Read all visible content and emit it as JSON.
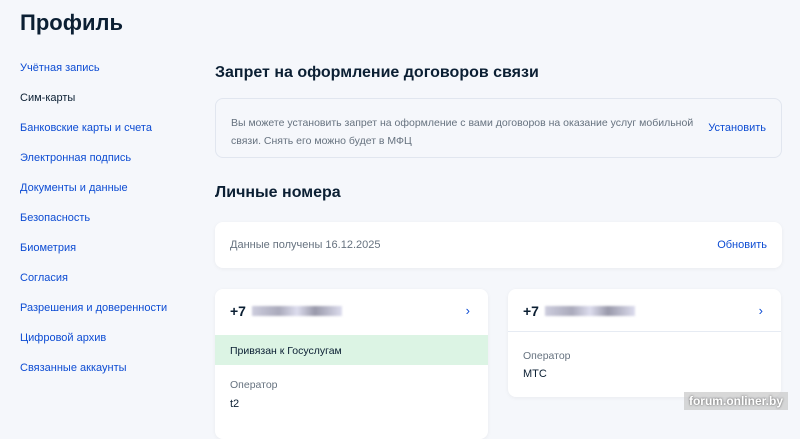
{
  "title": "Профиль",
  "nav": [
    "Учётная запись",
    "Сим-карты",
    "Банковские карты и счета",
    "Электронная подпись",
    "Документы и данные",
    "Безопасность",
    "Биометрия",
    "Согласия",
    "Разрешения и доверенности",
    "Цифровой архив",
    "Связанные аккаунты"
  ],
  "ban": {
    "heading": "Запрет на оформление договоров связи",
    "text": "Вы можете установить запрет на оформление с вами договоров на оказание услуг мобильной связи. Снять его можно будет в МФЦ",
    "action": "Установить"
  },
  "personal": {
    "heading": "Личные номера",
    "received": "Данные получены 16.12.2025",
    "refresh": "Обновить"
  },
  "numbers": [
    {
      "prefix": "+7",
      "linked": "Привязан к Госуслугам",
      "operator_label": "Оператор",
      "operator": "t2"
    },
    {
      "prefix": "+7",
      "operator_label": "Оператор",
      "operator": "МТС"
    }
  ],
  "watermark": "forum.onliner.by"
}
